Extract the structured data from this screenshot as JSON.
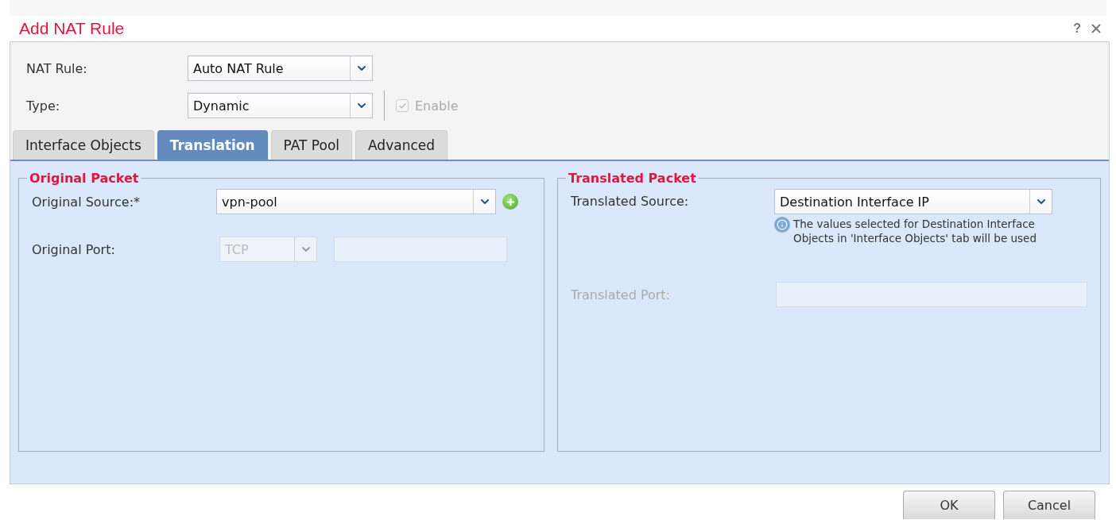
{
  "dialog": {
    "title": "Add NAT Rule",
    "help": "?"
  },
  "fields": [
    {
      "label": "NAT Rule:",
      "value": "Auto NAT Rule"
    },
    {
      "label": "Type:",
      "value": "Dynamic"
    }
  ],
  "enable": {
    "label": "Enable",
    "checked": true,
    "disabled": true
  },
  "tabs": [
    {
      "label": "Interface Objects",
      "selected": false
    },
    {
      "label": "Translation",
      "selected": true
    },
    {
      "label": "PAT Pool",
      "selected": false
    },
    {
      "label": "Advanced",
      "selected": false
    }
  ],
  "original_packet": {
    "legend": "Original Packet",
    "source": {
      "label": "Original Source:*",
      "value": "vpn-pool"
    },
    "port": {
      "label": "Original Port:",
      "protocol": "TCP",
      "disabled": true
    }
  },
  "translated_packet": {
    "legend": "Translated Packet",
    "source": {
      "label": "Translated Source:",
      "value": "Destination Interface IP"
    },
    "info": "The values selected for Destination Interface Objects in 'Interface Objects' tab will be used",
    "port": {
      "label": "Translated Port:",
      "disabled": true
    }
  },
  "buttons": [
    "OK",
    "Cancel"
  ]
}
